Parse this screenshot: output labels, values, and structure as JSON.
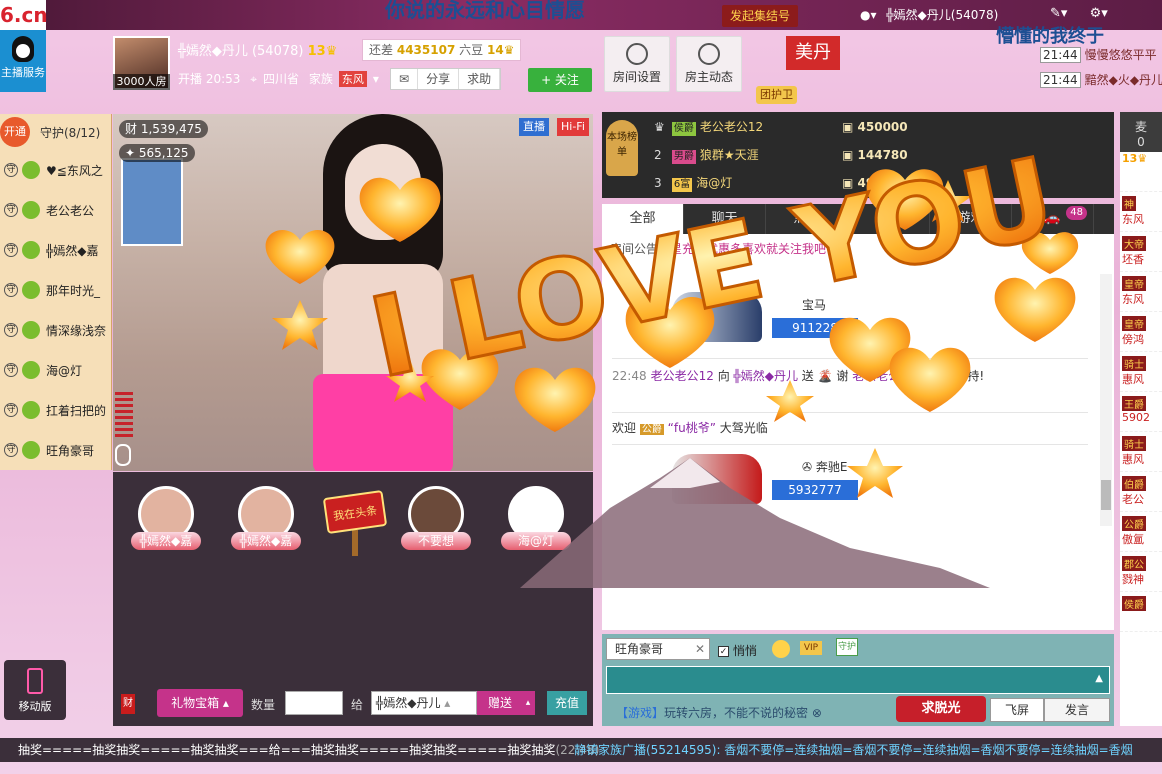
{
  "topbar": {
    "logo": "6.cn",
    "logo_small": "六间房",
    "marquee": "你说的永远和心目情愿",
    "join_label": "发起集结号",
    "user_label": "╬嫣然◆丹儿(54078)"
  },
  "service": {
    "label": "主播服务"
  },
  "anchor": {
    "name": "╬嫣然◆丹儿 (54078)",
    "level": "13",
    "gap_prefix": "还差",
    "gap_value": "4435107",
    "gap_suffix": "六豆",
    "next_level": "14",
    "fans": "3000人房",
    "start_time": "开播 20:53",
    "location": "四川省",
    "family_prefix": "家族",
    "family": "东风",
    "actions": [
      "分享",
      "求助"
    ],
    "follow_label": "+ 关注"
  },
  "header_buttons": [
    {
      "label": "房间设置",
      "icon": "gear-icon"
    },
    {
      "label": "房主动态",
      "icon": "user-icon"
    }
  ],
  "meidan": "美丹",
  "guard_team": "团护卫",
  "greeting": "懵懂的我终于",
  "notices": [
    {
      "time": "21:44",
      "text": "慢慢悠悠平平"
    },
    {
      "time": "21:44",
      "text": "黯然◆火◆丹儿"
    }
  ],
  "guard": {
    "open_label": "开通",
    "title": "守护(8/12)",
    "items": [
      {
        "badge": "守",
        "name": "♥≦东风之"
      },
      {
        "badge": "守",
        "name": "老公老公"
      },
      {
        "badge": "守",
        "name": "╬嫣然◆嘉"
      },
      {
        "badge": "守",
        "name": "那年时光_"
      },
      {
        "badge": "守",
        "name": "情深缘浅奈"
      },
      {
        "badge": "守",
        "name": "海@灯"
      },
      {
        "badge": "守",
        "name": "扛着扫把的"
      },
      {
        "badge": "守",
        "name": "旺角豪哥"
      }
    ]
  },
  "video": {
    "live": "直播",
    "hifi": "Hi-Fi",
    "wealth": "1,539,475",
    "wealth_label": "财",
    "popularity": "565,125"
  },
  "seats": [
    {
      "name": "╬嫣然◆嘉"
    },
    {
      "name": "╬嫣然◆嘉"
    },
    {
      "name": "不要想"
    },
    {
      "name": "海@灯"
    }
  ],
  "headline": "我在头条",
  "ranking": {
    "tag": "本场榜单",
    "rows": [
      {
        "no": "",
        "badge": "侯爵",
        "name": "老公老公12",
        "score": "450000"
      },
      {
        "no": "2",
        "badge": "男爵",
        "name": "狼群★天涯",
        "score": "144780"
      },
      {
        "no": "3",
        "badge": "6富",
        "name": "海@灯",
        "score": "49"
      }
    ]
  },
  "tabs": [
    {
      "label": "全部",
      "active": true
    },
    {
      "label": "聊天",
      "active": false
    },
    {
      "label": "点歌",
      "active": false
    },
    {
      "label": "礼物",
      "active": false
    },
    {
      "label": "游戏",
      "active": false
    }
  ],
  "car_count": "48",
  "chat": {
    "notice_prefix": "房间公告：",
    "notice_link": "星充值优惠多",
    "notice_suffix": "喜欢就关注我吧",
    "cars": [
      {
        "name": "宝马",
        "value": "911228"
      },
      {
        "name": "奔驰E",
        "value": "5932777"
      }
    ],
    "line1_time": "22:48",
    "line1_user": "老公老公12",
    "line1_mid": " 向 ",
    "line1_target": "╬嫣然◆丹儿",
    "line1_action": " 送",
    "line1_thanks": " 谢 ",
    "line1_thanks_user": "老公老公12",
    "line1_end": " 的热情支持!",
    "welcome_prefix": "欢迎 ",
    "welcome_badge": "公爵",
    "welcome_user": "“fu桃爷”",
    "welcome_suffix": " 大驾光临"
  },
  "input": {
    "to_user": "旺角豪哥",
    "whisper": "悄悄",
    "vip": "VIP",
    "guard": "守护",
    "hint_tag": "【游戏】",
    "hint_text": "玩转六房，不能不说的秘密",
    "qiu_label": "求脱光",
    "fly_label": "飞屏",
    "speak_label": "发言"
  },
  "gift": {
    "cai": "财",
    "box_label": "礼物宝箱",
    "qty_label": "数量",
    "give_label": "给",
    "target": "╬嫣然◆丹儿",
    "send_label": "赠送",
    "recharge_label": "充值"
  },
  "mobile": {
    "label": "移动版"
  },
  "right_col": {
    "head": "麦",
    "head_count": "0",
    "level": "13",
    "items": [
      "神",
      "东风",
      "大帝",
      "坯香",
      "皇帝",
      "东风",
      "皇帝",
      "傍鸿",
      "骑士",
      "惠风",
      "王爵",
      "5902",
      "骑士",
      "惠风",
      "伯爵",
      "老公",
      "公爵",
      "傲氲",
      "郡公",
      "戮神",
      "侯爵"
    ]
  },
  "ticker": {
    "left": "抽奖=====抽奖抽奖=====抽奖抽奖===给===抽奖抽奖=====抽奖抽奖=====抽奖抽奖",
    "left_time": "(22:48)",
    "right": "静镇家族广播(55214595): 香烟不要停=连续抽烟=香烟不要停=连续抽烟=香烟不要停=连续抽烟=香烟"
  },
  "overlay": {
    "text": "I LOVE YOU",
    "color": "#f6a623"
  }
}
